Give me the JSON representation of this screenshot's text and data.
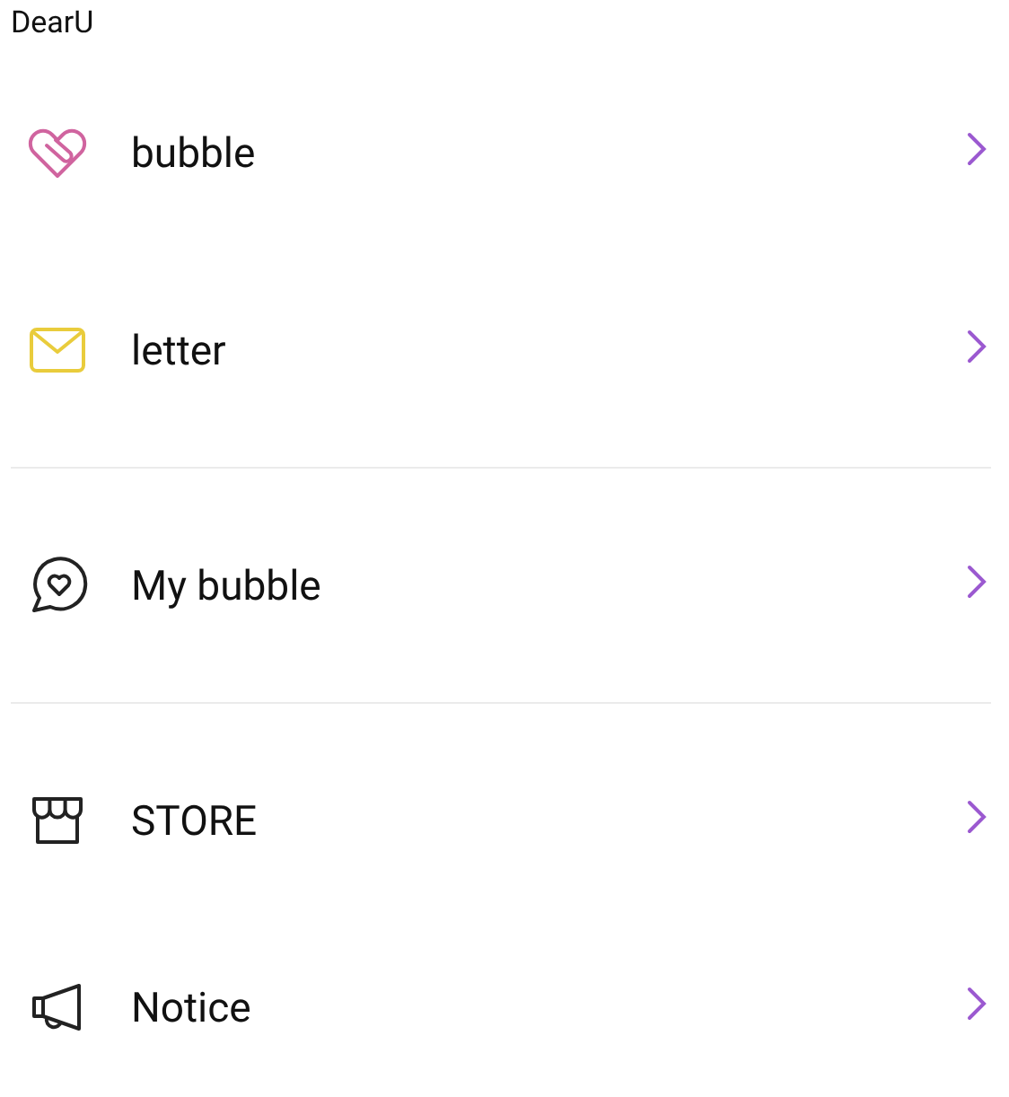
{
  "app_title": "DearU",
  "groups": [
    {
      "items": [
        {
          "label": "bubble"
        },
        {
          "label": "letter"
        }
      ]
    },
    {
      "items": [
        {
          "label": "My bubble"
        }
      ]
    },
    {
      "items": [
        {
          "label": "STORE"
        },
        {
          "label": "Notice"
        }
      ]
    }
  ]
}
